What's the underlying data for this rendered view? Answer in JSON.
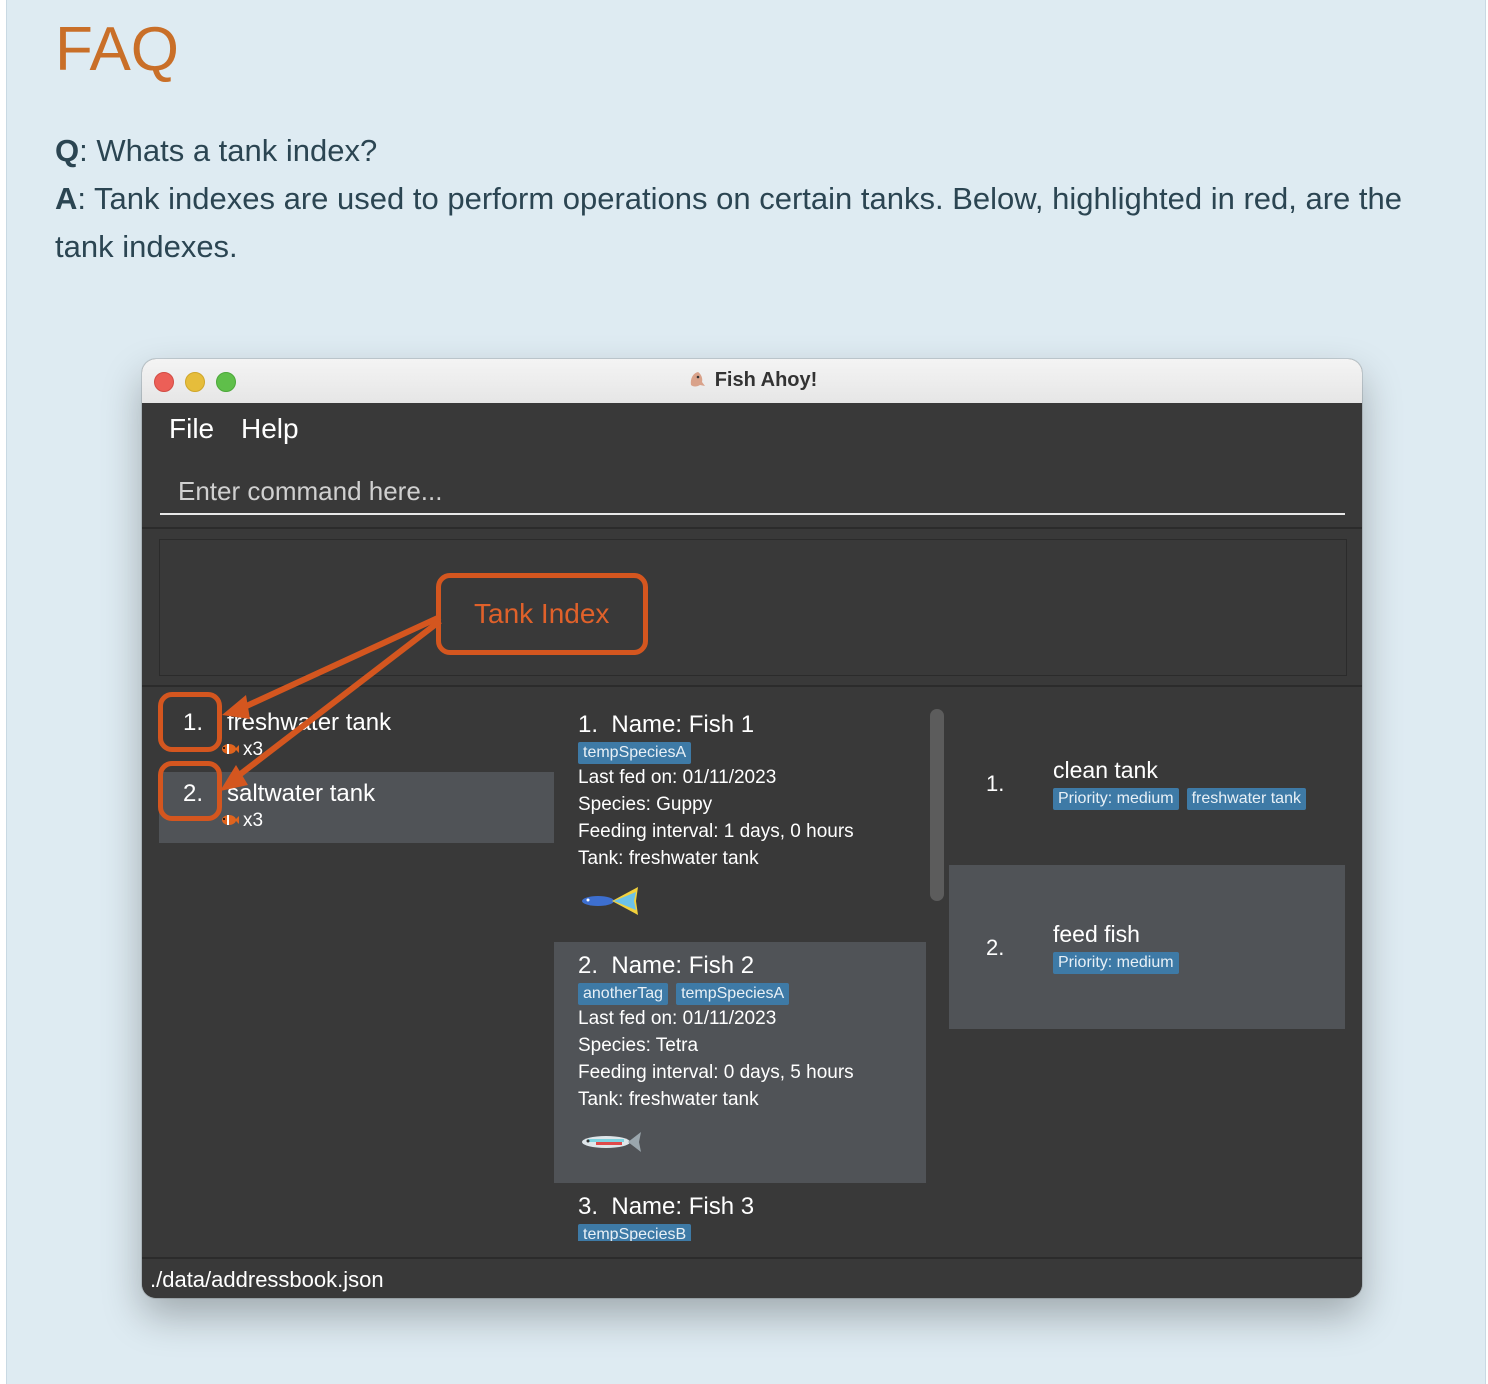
{
  "page": {
    "heading": "FAQ",
    "question_label": "Q",
    "question_text": ": Whats a tank index?",
    "answer_label": "A",
    "answer_text": ": Tank indexes are used to perform operations on certain tanks. Below, highlighted in red, are the tank indexes."
  },
  "window": {
    "title": "Fish Ahoy!",
    "menu": {
      "file": "File",
      "help": "Help"
    },
    "command": {
      "placeholder": "Enter command here...",
      "value": ""
    },
    "annotation": {
      "label": "Tank Index",
      "color": "#d4561f"
    },
    "tanks": [
      {
        "index": "1.",
        "name": "freshwater tank",
        "count": "x3"
      },
      {
        "index": "2.",
        "name": "saltwater tank",
        "count": "x3"
      }
    ],
    "fish": [
      {
        "index": "1.",
        "name": "Name: Fish 1",
        "tags": [
          "tempSpeciesA"
        ],
        "last_fed": "Last fed on: 01/11/2023",
        "species": "Species: Guppy",
        "feeding_interval": "Feeding interval: 1 days, 0 hours",
        "tank": "Tank: freshwater tank",
        "icon": "guppy-icon"
      },
      {
        "index": "2.",
        "name": "Name: Fish 2",
        "tags": [
          "anotherTag",
          "tempSpeciesA"
        ],
        "last_fed": "Last fed on: 01/11/2023",
        "species": "Species: Tetra",
        "feeding_interval": "Feeding interval: 0 days, 5 hours",
        "tank": "Tank: freshwater tank",
        "icon": "tetra-icon"
      },
      {
        "index": "3.",
        "name": "Name: Fish 3",
        "tags": [
          "tempSpeciesB"
        ]
      }
    ],
    "tasks": [
      {
        "index": "1.",
        "name": "clean tank",
        "tags": [
          "Priority: medium",
          "freshwater tank"
        ]
      },
      {
        "index": "2.",
        "name": "feed fish",
        "tags": [
          "Priority: medium"
        ]
      }
    ],
    "status": "./data/addressbook.json"
  },
  "colors": {
    "page_bg": "#deebf2",
    "heading": "#c96f28",
    "app_bg": "#393939",
    "tag_bg": "#3e7aa6",
    "annotation": "#d4561f"
  }
}
